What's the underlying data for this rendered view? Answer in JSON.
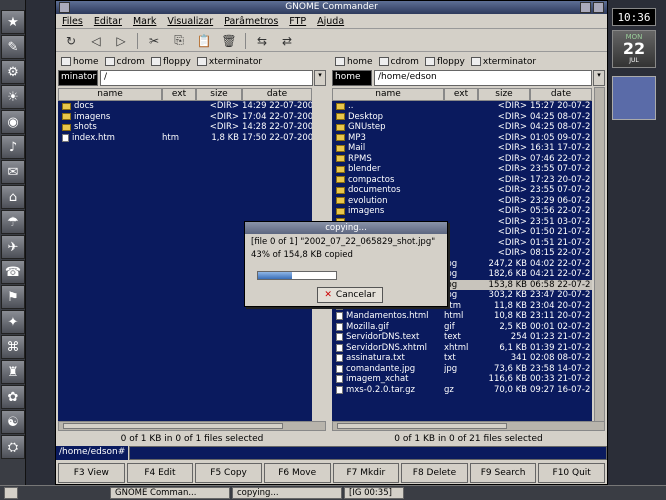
{
  "window": {
    "title": "GNOME Commander"
  },
  "menu": [
    "Files",
    "Editar",
    "Mark",
    "Visualizar",
    "Parâmetros",
    "FTP",
    "Ajuda"
  ],
  "toolbar": [
    "refresh-icon",
    "back-icon",
    "forward-icon",
    "cut-icon",
    "copy-icon",
    "paste-icon",
    "delete-icon",
    "connect-icon",
    "disconnect-icon"
  ],
  "left": {
    "devices": [
      "home",
      "cdrom",
      "floppy",
      "xterminator"
    ],
    "connection": "minator",
    "path": "/",
    "headers": {
      "name": "name",
      "ext": "ext",
      "size": "size",
      "date": "date"
    },
    "files": [
      {
        "name": "docs",
        "ext": "",
        "size": "<DIR>",
        "date": "14:29 22-07-200",
        "type": "dir"
      },
      {
        "name": "imagens",
        "ext": "",
        "size": "<DIR>",
        "date": "17:04 22-07-200",
        "type": "dir"
      },
      {
        "name": "shots",
        "ext": "",
        "size": "<DIR>",
        "date": "14:28 22-07-200",
        "type": "dir"
      },
      {
        "name": "index.htm",
        "ext": "htm",
        "size": "1,8 KB",
        "date": "17:50 22-07-200",
        "type": "file"
      }
    ],
    "status": "0 of 1 KB in 0 of 1 files selected"
  },
  "right": {
    "devices": [
      "home",
      "cdrom",
      "floppy",
      "xterminator"
    ],
    "connection": "home",
    "path": "/home/edson",
    "headers": {
      "name": "name",
      "ext": "ext",
      "size": "size",
      "date": "date"
    },
    "files": [
      {
        "name": "..",
        "ext": "",
        "size": "<DIR>",
        "date": "15:27 20-07-2",
        "type": "dir"
      },
      {
        "name": "Desktop",
        "ext": "",
        "size": "<DIR>",
        "date": "04:25 08-07-2",
        "type": "dir"
      },
      {
        "name": "GNUstep",
        "ext": "",
        "size": "<DIR>",
        "date": "04:25 08-07-2",
        "type": "dir"
      },
      {
        "name": "MP3",
        "ext": "",
        "size": "<DIR>",
        "date": "01:05 09-07-2",
        "type": "dir"
      },
      {
        "name": "Mail",
        "ext": "",
        "size": "<DIR>",
        "date": "16:31 17-07-2",
        "type": "dir"
      },
      {
        "name": "RPMS",
        "ext": "",
        "size": "<DIR>",
        "date": "07:46 22-07-2",
        "type": "dir"
      },
      {
        "name": "blender",
        "ext": "",
        "size": "<DIR>",
        "date": "23:55 07-07-2",
        "type": "dir"
      },
      {
        "name": "compactos",
        "ext": "",
        "size": "<DIR>",
        "date": "17:23 20-07-2",
        "type": "dir"
      },
      {
        "name": "documentos",
        "ext": "",
        "size": "<DIR>",
        "date": "23:55 07-07-2",
        "type": "dir"
      },
      {
        "name": "evolution",
        "ext": "",
        "size": "<DIR>",
        "date": "23:29 06-07-2",
        "type": "dir"
      },
      {
        "name": "imagens",
        "ext": "",
        "size": "<DIR>",
        "date": "05:56 22-07-2",
        "type": "dir"
      },
      {
        "name": "",
        "ext": "",
        "size": "<DIR>",
        "date": "23:51 03-07-2",
        "type": "dir"
      },
      {
        "name": "",
        "ext": "",
        "size": "<DIR>",
        "date": "01:50 21-07-2",
        "type": "dir"
      },
      {
        "name": "",
        "ext": "",
        "size": "<DIR>",
        "date": "01:51 21-07-2",
        "type": "dir"
      },
      {
        "name": "",
        "ext": "",
        "size": "<DIR>",
        "date": "08:15 22-07-2",
        "type": "dir"
      },
      {
        "name": "",
        "ext": "jpg",
        "size": "247,2 KB",
        "date": "04:02 22-07-2",
        "type": "file"
      },
      {
        "name": "",
        "ext": "jpg",
        "size": "182,6 KB",
        "date": "04:21 22-07-2",
        "type": "file"
      },
      {
        "name": "",
        "ext": "jpg",
        "size": "153,8 KB",
        "date": "06:58 22-07-2",
        "type": "file",
        "selected": true
      },
      {
        "name": "",
        "ext": "jpg",
        "size": "303,2 KB",
        "date": "23:47 20-07-2",
        "type": "file"
      },
      {
        "name": "Mandamentos.htm",
        "ext": "htm",
        "size": "11,8 KB",
        "date": "23:04 20-07-2",
        "type": "file"
      },
      {
        "name": "Mandamentos.html",
        "ext": "html",
        "size": "10,8 KB",
        "date": "23:11 20-07-2",
        "type": "file"
      },
      {
        "name": "Mozilla.gif",
        "ext": "gif",
        "size": "2,5 KB",
        "date": "00:01 02-07-2",
        "type": "file"
      },
      {
        "name": "ServidorDNS.text",
        "ext": "text",
        "size": "254",
        "date": "01:23 21-07-2",
        "type": "file"
      },
      {
        "name": "ServidorDNS.xhtml",
        "ext": "xhtml",
        "size": "6,1 KB",
        "date": "01:39 21-07-2",
        "type": "file"
      },
      {
        "name": "assinatura.txt",
        "ext": "txt",
        "size": "341",
        "date": "02:08 08-07-2",
        "type": "file"
      },
      {
        "name": "comandante.jpg",
        "ext": "jpg",
        "size": "73,6 KB",
        "date": "23:58 14-07-2",
        "type": "file"
      },
      {
        "name": "imagem_xchat",
        "ext": "",
        "size": "116,6 KB",
        "date": "00:33 21-07-2",
        "type": "file"
      },
      {
        "name": "mxs-0.2.0.tar.gz",
        "ext": "gz",
        "size": "70,0 KB",
        "date": "09:27 16-07-2",
        "type": "file"
      }
    ],
    "status": "0 of 1 KB in 0 of 21 files selected"
  },
  "cmdline": {
    "label": "/home/edson#"
  },
  "fkeys": [
    "F3 View",
    "F4 Edit",
    "F5 Copy",
    "F6 Move",
    "F7 Mkdir",
    "F8 Delete",
    "F9 Search",
    "F10 Quit"
  ],
  "dialog": {
    "title": "copying...",
    "line1": "[file 0 of 1] \"2002_07_22_065829_shot.jpg\"",
    "line2": "43% of 154,8 KB copied",
    "progress": 0.43,
    "cancel": "Cancelar"
  },
  "clock": {
    "time": "10:36",
    "month": "MON",
    "day": "22",
    "weekday": "JUL"
  },
  "taskbar": {
    "tasks": [
      "GNOME Comman...",
      "copying...",
      "[IG 00:35]"
    ]
  }
}
